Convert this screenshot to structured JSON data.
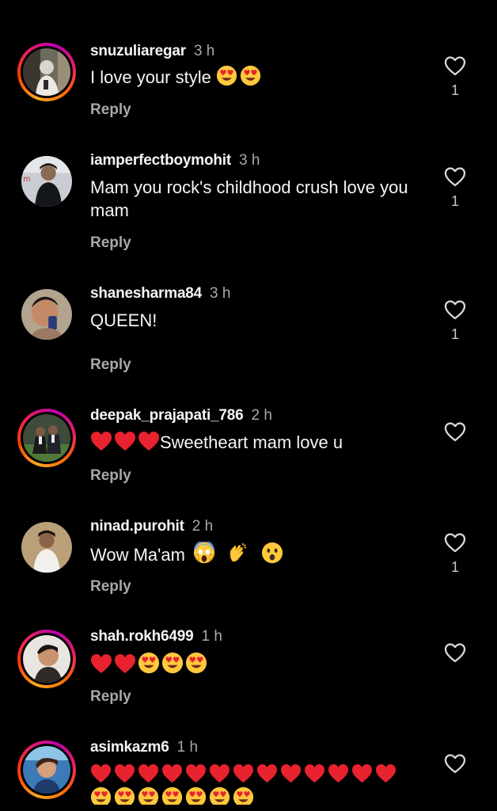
{
  "comments": [
    {
      "username": "snuzuliaregar",
      "time": "3 h",
      "text": "I love your style",
      "emojis_after": [
        "heart-eyes",
        "heart-eyes"
      ],
      "reply_label": "Reply",
      "likes": "1",
      "story_ring": true,
      "avatar": "avatar-snuzuliaregar"
    },
    {
      "username": "iamperfectboymohit",
      "time": "3 h",
      "text": "Mam you rock's childhood crush love you mam",
      "reply_label": "Reply",
      "likes": "1",
      "story_ring": false,
      "avatar": "avatar-iamperfectboymohit"
    },
    {
      "username": "shanesharma84",
      "time": "3 h",
      "text": "QUEEN!",
      "reply_label": "Reply",
      "likes": "1",
      "story_ring": false,
      "avatar": "avatar-shanesharma84"
    },
    {
      "username": "deepak_prajapati_786",
      "time": "2 h",
      "emojis_before": [
        "red-heart",
        "red-heart",
        "red-heart"
      ],
      "text": "Sweetheart mam love u",
      "reply_label": "Reply",
      "likes": "",
      "story_ring": true,
      "avatar": "avatar-deepak"
    },
    {
      "username": "ninad.purohit",
      "time": "2 h",
      "text": "Wow Ma'am",
      "emojis_after": [
        "screaming-face",
        "clapping-hands",
        "astonished-face"
      ],
      "reply_label": "Reply",
      "likes": "1",
      "story_ring": false,
      "avatar": "avatar-ninad"
    },
    {
      "username": "shah.rokh6499",
      "time": "1 h",
      "text": "",
      "emojis_after": [
        "red-heart",
        "red-heart",
        "heart-eyes",
        "heart-eyes",
        "heart-eyes"
      ],
      "reply_label": "Reply",
      "likes": "",
      "story_ring": true,
      "avatar": "avatar-shahrokh"
    },
    {
      "username": "asimkazm6",
      "time": "1 h",
      "text": "",
      "emojis_line1": [
        "red-heart",
        "red-heart",
        "red-heart",
        "red-heart",
        "red-heart",
        "red-heart",
        "red-heart",
        "red-heart",
        "red-heart",
        "red-heart",
        "red-heart",
        "red-heart",
        "red-heart"
      ],
      "emojis_line2": [
        "heart-eyes",
        "heart-eyes",
        "heart-eyes",
        "heart-eyes",
        "heart-eyes",
        "heart-eyes",
        "heart-eyes"
      ],
      "likes": "",
      "story_ring": true,
      "avatar": "avatar-asimkazm6"
    }
  ],
  "colors": {
    "background": "#000000",
    "text": "#f5f5f5",
    "secondary": "#a8a8a8",
    "heart_red": "#e8222e",
    "emoji_yellow": "#ffc83d"
  }
}
